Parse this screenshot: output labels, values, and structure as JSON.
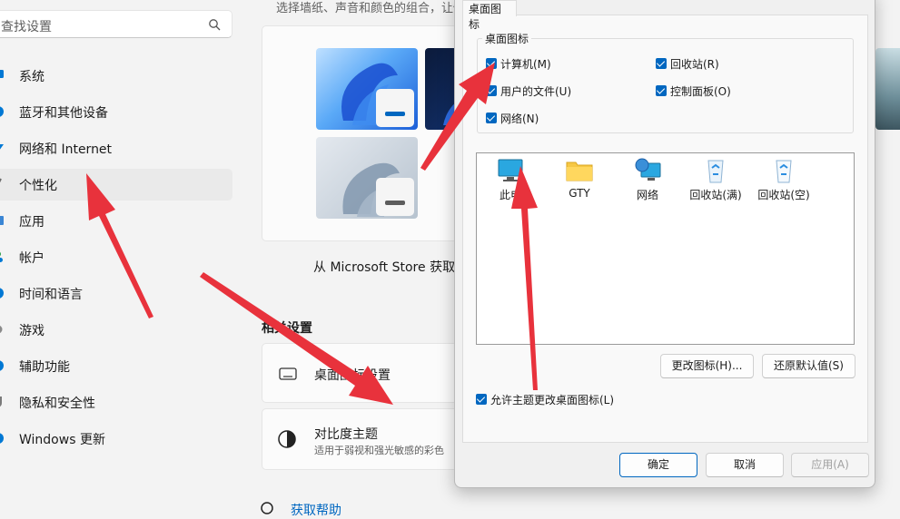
{
  "search": {
    "placeholder": "查找设置"
  },
  "nav": [
    {
      "label": "系统",
      "icon": "monitor-icon",
      "color": "#0078d4"
    },
    {
      "label": "蓝牙和其他设备",
      "icon": "bluetooth-icon",
      "color": "#0078d4"
    },
    {
      "label": "网络和 Internet",
      "icon": "wifi-icon",
      "color": "#0078d4"
    },
    {
      "label": "个性化",
      "icon": "brush-icon",
      "color": "#6b6b6b"
    },
    {
      "label": "应用",
      "icon": "apps-icon",
      "color": "#0078d4"
    },
    {
      "label": "帐户",
      "icon": "person-icon",
      "color": "#0078d4"
    },
    {
      "label": "时间和语言",
      "icon": "globe-icon",
      "color": "#0078d4"
    },
    {
      "label": "游戏",
      "icon": "gamepad-icon",
      "color": "#7a7a7a"
    },
    {
      "label": "辅助功能",
      "icon": "accessibility-icon",
      "color": "#0078d4"
    },
    {
      "label": "隐私和安全性",
      "icon": "shield-icon",
      "color": "#7a7a7a"
    },
    {
      "label": "Windows 更新",
      "icon": "update-icon",
      "color": "#0078d4"
    }
  ],
  "active_nav": "个性化",
  "content": {
    "header_partial": "选择墙纸、声音和颜色的组合，让你",
    "store_link": "从 Microsoft Store 获取更",
    "related_title": "相关设置",
    "desktop_icon_settings": "桌面图标设置",
    "contrast_title": "对比度主题",
    "contrast_sub": "适用于弱视和强光敏感的彩色",
    "help_link": "获取帮助"
  },
  "dialog": {
    "tab": "桌面图标",
    "group_label": "桌面图标",
    "checkboxes": [
      {
        "label": "计算机(M)",
        "checked": true
      },
      {
        "label": "回收站(R)",
        "checked": true
      },
      {
        "label": "用户的文件(U)",
        "checked": true
      },
      {
        "label": "控制面板(O)",
        "checked": true
      },
      {
        "label": "网络(N)",
        "checked": true
      }
    ],
    "icons": [
      {
        "label": "此电",
        "icon": "computer-icon"
      },
      {
        "label": "GTY",
        "icon": "folder-icon"
      },
      {
        "label": "网络",
        "icon": "network-icon"
      },
      {
        "label": "回收站(满)",
        "icon": "recycle-bin-full-icon"
      },
      {
        "label": "回收站(空)",
        "icon": "recycle-bin-empty-icon"
      }
    ],
    "change_icon": "更改图标(H)...",
    "restore_default": "还原默认值(S)",
    "allow_themes": "允许主题更改桌面图标(L)",
    "allow_themes_checked": true,
    "ok": "确定",
    "cancel": "取消",
    "apply": "应用(A)"
  },
  "colors": {
    "accent": "#0067c0",
    "arrow": "#e8323c"
  }
}
